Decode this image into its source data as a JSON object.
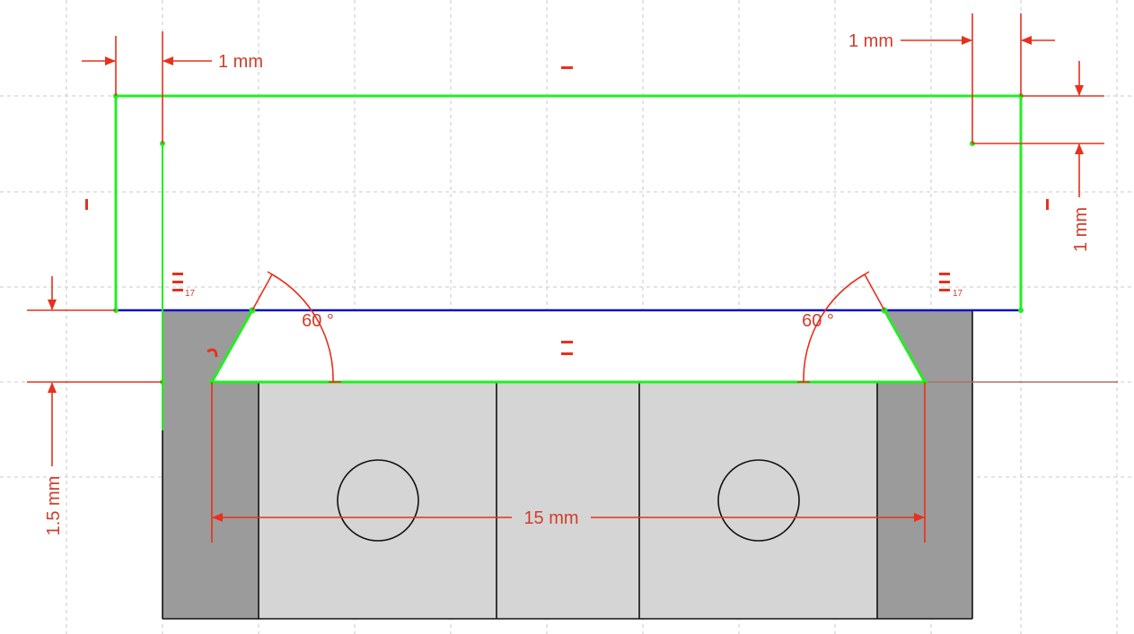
{
  "dimensions": {
    "left_offset": "1 mm",
    "right_offset": "1 mm",
    "right_vertical": "1 mm",
    "left_height": "1.5 mm",
    "bottom_width": "15 mm",
    "angle_left": "60 °",
    "angle_right": "60 °"
  },
  "constraint_labels": {
    "left_index": "17",
    "right_index": "17"
  },
  "colors": {
    "sketch_geometry": "#22ee22",
    "construction_line": "#1010cc",
    "dimension": "#e8301c",
    "solid_dark": "#9b9b9b",
    "solid_light": "#d5d5d5"
  }
}
